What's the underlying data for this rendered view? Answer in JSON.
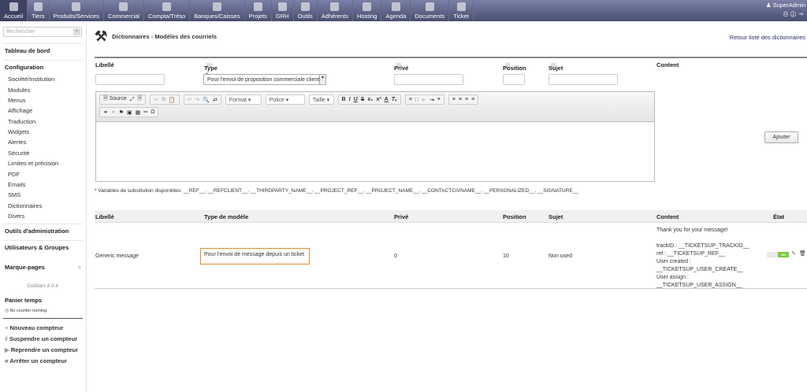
{
  "topmenu": [
    {
      "label": "Accueil",
      "icon": "home-icon"
    },
    {
      "label": "Tiers",
      "icon": "company-icon"
    },
    {
      "label": "Produits/Services",
      "icon": "products-icon"
    },
    {
      "label": "Commercial",
      "icon": "commercial-icon"
    },
    {
      "label": "Compta/Tréso",
      "icon": "accounting-icon"
    },
    {
      "label": "Banques/Caisses",
      "icon": "bank-icon"
    },
    {
      "label": "Projets",
      "icon": "projects-icon"
    },
    {
      "label": "GRH",
      "icon": "hr-icon"
    },
    {
      "label": "Outils",
      "icon": "tools-icon"
    },
    {
      "label": "Adhérents",
      "icon": "members-icon"
    },
    {
      "label": "Hosting",
      "icon": "globe-icon"
    },
    {
      "label": "Agenda",
      "icon": "agenda-icon"
    },
    {
      "label": "Documents",
      "icon": "documents-icon"
    },
    {
      "label": "Ticket",
      "icon": "ticket-icon"
    }
  ],
  "user": {
    "name": "SuperAdmin"
  },
  "sidebar": {
    "search_placeholder": "Rechercher",
    "dashboard": "Tableau de bord",
    "config": "Configuration",
    "items": [
      "Société/Institution",
      "Modules",
      "Menus",
      "Affichage",
      "Traduction",
      "Widgets",
      "Alertes",
      "Sécurité",
      "Limites et précision",
      "PDF",
      "Emails",
      "SMS",
      "Dictionnaires",
      "Divers"
    ],
    "admin_tools": "Outils d'administration",
    "users": "Utilisateurs & Groupes",
    "bookmarks": "Marque-pages",
    "version": "Dolibarr 4.0.4",
    "timesheet": "Panier temps",
    "no_counter": "No counter running",
    "counters": [
      "Nouveau compteur",
      "Suspendre un compteur",
      "Reprendre un compteur",
      "Arrêter un compteur"
    ]
  },
  "page": {
    "title": "Dictionnaires - Modèles des courriels",
    "back": "Retour liste des dictionnaires"
  },
  "columns": {
    "label": "Libellé",
    "type": "Type de modèle",
    "private": "Privé",
    "position": "Position",
    "subject": "Sujet",
    "content": "Content",
    "state": "État"
  },
  "form": {
    "type_selected": "Pour l'envoi de proposition commerciale client",
    "add": "Ajouter",
    "editor": {
      "source": "Source",
      "format": "Format",
      "font": "Police",
      "size": "Taille"
    }
  },
  "variables": "* Variables de substitution disponibles: __REF__, __REFCLIENT__, __THIRDPARTY_NAME__, __PROJECT_REF__, __PROJECT_NAME__, __CONTACTCIVNAME__, __PERSONALIZED__, __SIGNATURE__",
  "rows": [
    {
      "label": "Generic message",
      "type": "Pour l'envoi de message depuis un ticket",
      "private": "0",
      "position": "10",
      "subject": "Non used",
      "content": [
        "Thank you for your message!",
        "",
        "trackID : __TICKETSUP_TRACKID__",
        "ref : __TICKETSUP_REF__",
        "User created :",
        "__TICKETSUP_USER_CREATE__",
        "User assign :",
        "__TICKETSUP_USER_ASSIGN__"
      ],
      "state": "ON"
    }
  ]
}
